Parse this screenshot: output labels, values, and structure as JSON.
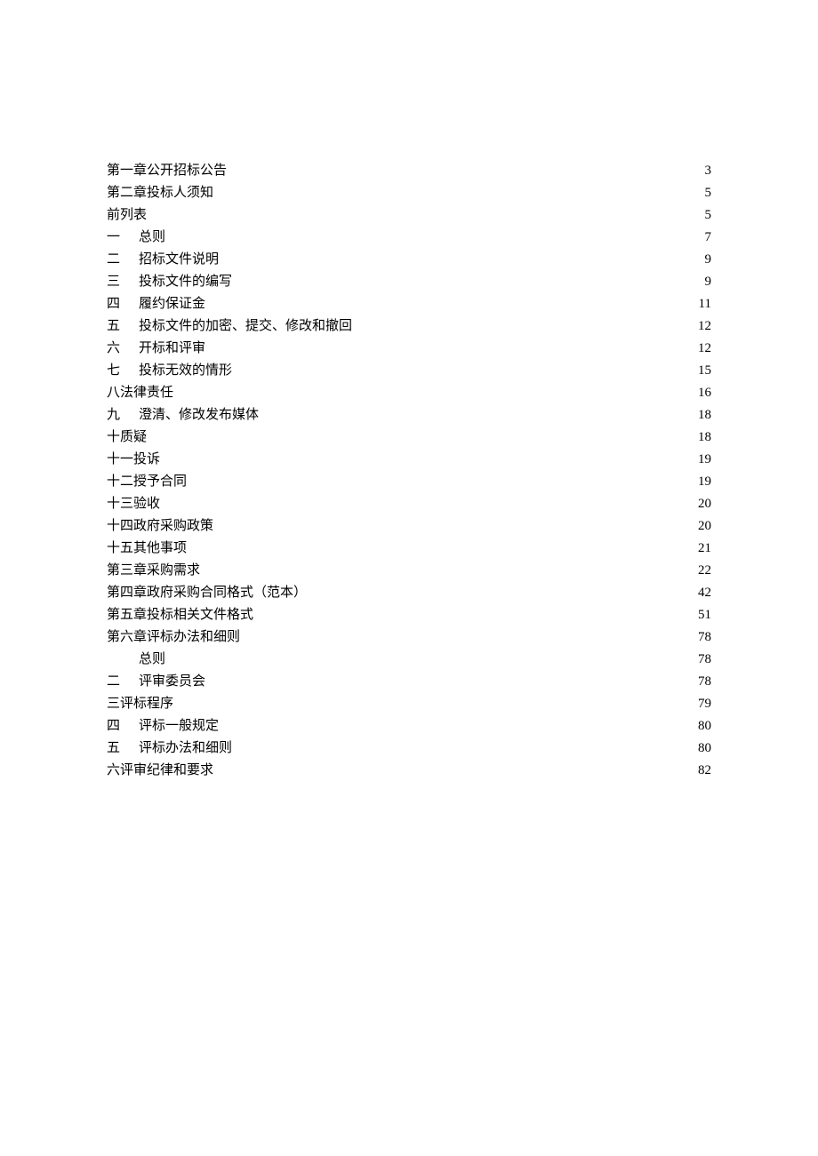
{
  "toc": {
    "entries": [
      {
        "number": "",
        "title": "第一章公开招标公告",
        "page": "3",
        "dense": false,
        "hasNumber": false
      },
      {
        "number": "",
        "title": "第二章投标人须知",
        "page": "5",
        "dense": false,
        "hasNumber": false
      },
      {
        "number": "",
        "title": "前列表",
        "page": "5",
        "dense": false,
        "hasNumber": false
      },
      {
        "number": "一",
        "title": "总则",
        "page": "7",
        "dense": true,
        "hasNumber": true
      },
      {
        "number": "二",
        "title": "招标文件说明",
        "page": "9",
        "dense": false,
        "hasNumber": true
      },
      {
        "number": "三",
        "title": "投标文件的编写",
        "page": "9",
        "dense": false,
        "hasNumber": true
      },
      {
        "number": "四",
        "title": "履约保证金",
        "page": "11",
        "dense": false,
        "hasNumber": true
      },
      {
        "number": "五",
        "title": "投标文件的加密、提交、修改和撤回",
        "page": "12",
        "dense": false,
        "hasNumber": true
      },
      {
        "number": "六",
        "title": "开标和评审",
        "page": "12",
        "dense": false,
        "hasNumber": true
      },
      {
        "number": "七",
        "title": "投标无效的情形",
        "page": "15",
        "dense": false,
        "hasNumber": true
      },
      {
        "number": "",
        "title": "八法律责任",
        "page": "16",
        "dense": false,
        "hasNumber": false
      },
      {
        "number": "九",
        "title": "澄清、修改发布媒体",
        "page": "18",
        "dense": false,
        "hasNumber": true
      },
      {
        "number": "",
        "title": "十质疑",
        "page": "18",
        "dense": false,
        "hasNumber": false
      },
      {
        "number": "",
        "title": "十一投诉",
        "page": "19",
        "dense": false,
        "hasNumber": false
      },
      {
        "number": "",
        "title": "十二授予合同",
        "page": "19",
        "dense": false,
        "hasNumber": false
      },
      {
        "number": "",
        "title": "十三验收",
        "page": "20",
        "dense": false,
        "hasNumber": false
      },
      {
        "number": "",
        "title": "十四政府采购政策",
        "page": "20",
        "dense": false,
        "hasNumber": false
      },
      {
        "number": "",
        "title": "十五其他事项",
        "page": "21",
        "dense": false,
        "hasNumber": false
      },
      {
        "number": "",
        "title": "第三章采购需求",
        "page": "22",
        "dense": false,
        "hasNumber": false
      },
      {
        "number": "",
        "title": "第四章政府采购合同格式（范本）",
        "page": "42",
        "dense": false,
        "hasNumber": false
      },
      {
        "number": "",
        "title": "第五章投标相关文件格式",
        "page": "51",
        "dense": false,
        "hasNumber": false
      },
      {
        "number": "",
        "title": "第六章评标办法和细则",
        "page": "78",
        "dense": false,
        "hasNumber": false
      },
      {
        "number": "",
        "title": "总则",
        "page": "78",
        "dense": false,
        "hasNumber": true,
        "emptyNumber": true
      },
      {
        "number": "二",
        "title": "评审委员会",
        "page": "78",
        "dense": false,
        "hasNumber": true
      },
      {
        "number": "",
        "title": "三评标程序",
        "page": "79",
        "dense": false,
        "hasNumber": false
      },
      {
        "number": "四",
        "title": "评标一般规定",
        "page": "80",
        "dense": false,
        "hasNumber": true
      },
      {
        "number": "五",
        "title": "评标办法和细则",
        "page": "80",
        "dense": false,
        "hasNumber": true
      },
      {
        "number": "",
        "title": "六评审纪律和要求",
        "page": "82",
        "dense": false,
        "hasNumber": false
      }
    ]
  }
}
